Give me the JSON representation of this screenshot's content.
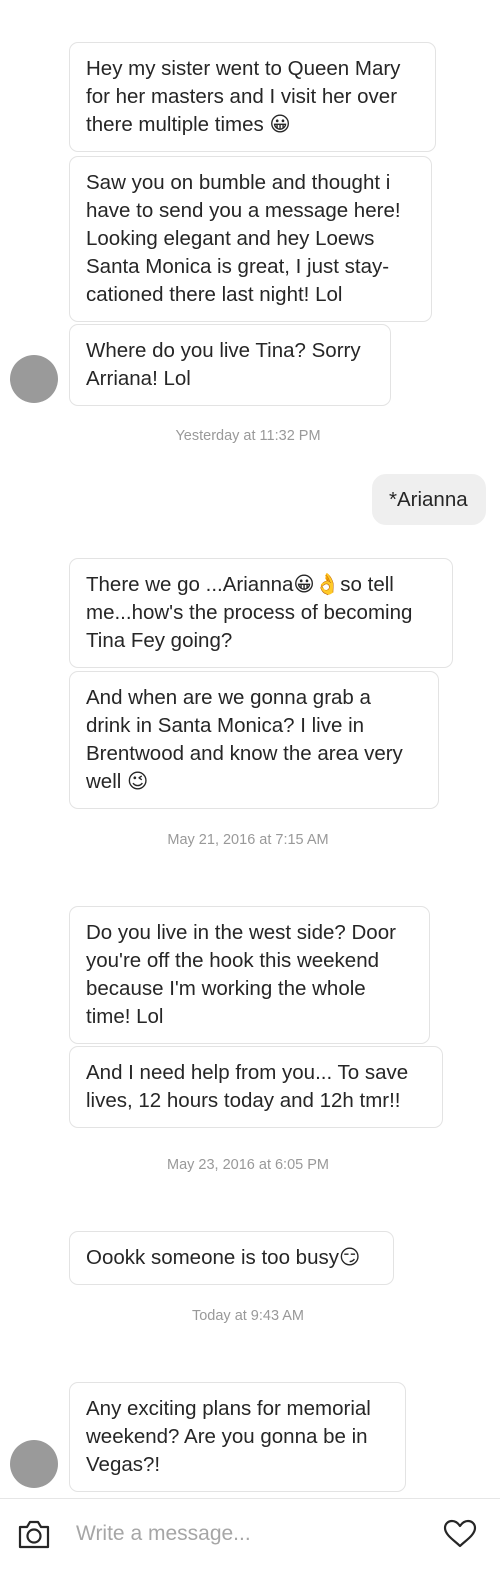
{
  "messages": [
    {
      "text": "Hey my sister went to Queen Mary\nfor her masters and I visit her over\nthere multiple times 😀"
    },
    {
      "text": "Saw you on bumble and thought i\nhave to send you a message here!\nLooking elegant and hey Loews\nSanta Monica is great, I just stay-\ncationed there last night! Lol"
    },
    {
      "text": "Where do you live Tina? Sorry\nArriana! Lol"
    },
    {
      "text": "*Arianna"
    },
    {
      "text": "There we go ...Arianna😀👌so tell\nme...how's the process of becoming\nTina Fey going?"
    },
    {
      "text": "And when are we gonna grab a\ndrink in Santa Monica? I live in\nBrentwood and know the area very\nwell 😉"
    },
    {
      "text": "Do you live in the west side? Door\nyou're off the hook this weekend\nbecause I'm working the whole\ntime! Lol"
    },
    {
      "text": "And I need help from you... To save\nlives, 12 hours today and 12h tmr!!"
    },
    {
      "text": "Oookk someone is too busy😏"
    },
    {
      "text": "Any exciting plans for memorial\nweekend? Are you gonna be in\nVegas?!"
    }
  ],
  "timestamps": [
    "Yesterday at 11:32 PM",
    "May 21, 2016 at 7:15 AM",
    "May 23, 2016 at 6:05 PM",
    "Today at 9:43 AM"
  ],
  "composer": {
    "placeholder": "Write a message...",
    "camera_icon": "camera-icon",
    "heart_icon": "heart-icon"
  },
  "colors": {
    "incoming_bubble_border": "#e3e3e3",
    "outgoing_bubble_bg": "#efefef",
    "timestamp_text": "#999999",
    "avatar_placeholder": "#9a9a9a"
  }
}
